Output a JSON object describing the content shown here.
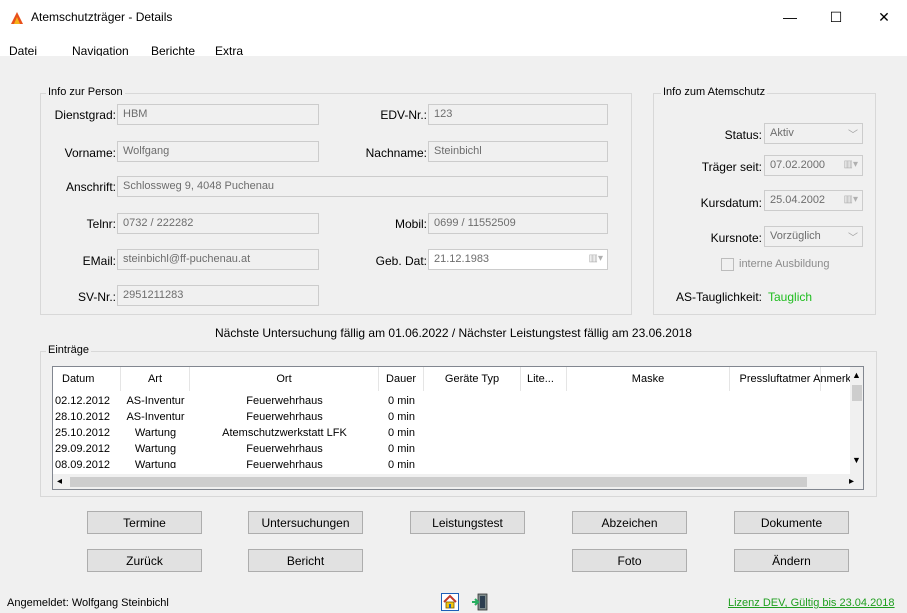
{
  "window": {
    "title": "Atemschutzträger - Details",
    "minimize": "—",
    "maximize": "☐",
    "close": "✕"
  },
  "menu": [
    "Datei",
    "Navigation",
    "Berichte",
    "Extra"
  ],
  "person": {
    "group_title": "Info zur Person",
    "dienstgrad_label": "Dienstgrad:",
    "dienstgrad": "HBM",
    "edv_label": "EDV-Nr.:",
    "edv": "123",
    "vorname_label": "Vorname:",
    "vorname": "Wolfgang",
    "nachname_label": "Nachname:",
    "nachname": "Steinbichl",
    "anschrift_label": "Anschrift:",
    "anschrift": "Schlossweg 9, 4048 Puchenau",
    "telnr_label": "Telnr:",
    "telnr": "0732 / 222282",
    "mobil_label": "Mobil:",
    "mobil": "0699 / 11552509",
    "email_label": "EMail:",
    "email": "steinbichl@ff-puchenau.at",
    "gebdat_label": "Geb. Dat:",
    "gebdat": "21.12.1983",
    "svnr_label": "SV-Nr.:",
    "svnr": "2951211283"
  },
  "atemschutz": {
    "group_title": "Info zum Atemschutz",
    "status_label": "Status:",
    "status": "Aktiv",
    "traeger_label": "Träger seit:",
    "traeger": "07.02.2000",
    "kurs_label": "Kursdatum:",
    "kurs": "25.04.2002",
    "note_label": "Kursnote:",
    "note": "Vorzüglich",
    "intern_label": "interne Ausbildung",
    "taug_label": "AS-Tauglichkeit:",
    "taug": "Tauglich",
    "taug_color": "#1fbd1f"
  },
  "notice": "Nächste Untersuchung fällig am 01.06.2022 / Nächster Leistungstest fällig am 23.06.2018",
  "entries": {
    "group_title": "Einträge",
    "columns": [
      "Datum",
      "Art",
      "Ort",
      "Dauer",
      "Geräte Typ",
      "Lite...",
      "Maske",
      "Pressluftatmer",
      "Anmerk"
    ],
    "rows": [
      [
        "02.12.2012",
        "AS-Inventur",
        "Feuerwehrhaus",
        "0 min"
      ],
      [
        "28.10.2012",
        "AS-Inventur",
        "Feuerwehrhaus",
        "0 min"
      ],
      [
        "25.10.2012",
        "Wartung",
        "Atemschutzwerkstatt LFK",
        "0 min"
      ],
      [
        "29.09.2012",
        "Wartung",
        "Feuerwehrhaus",
        "0 min"
      ],
      [
        "08.09.2012",
        "Wartung",
        "Feuerwehrhaus",
        "0 min"
      ]
    ]
  },
  "buttons": {
    "termine": "Termine",
    "untersuchungen": "Untersuchungen",
    "leistungstest": "Leistungstest",
    "abzeichen": "Abzeichen",
    "dokumente": "Dokumente",
    "zurueck": "Zurück",
    "bericht": "Bericht",
    "foto": "Foto",
    "aendern": "Ändern"
  },
  "status": {
    "user": "Angemeldet: Wolfgang Steinbichl",
    "license": "Lizenz DEV, Gültig bis 23.04.2018",
    "license_color": "#1e9e1e"
  }
}
